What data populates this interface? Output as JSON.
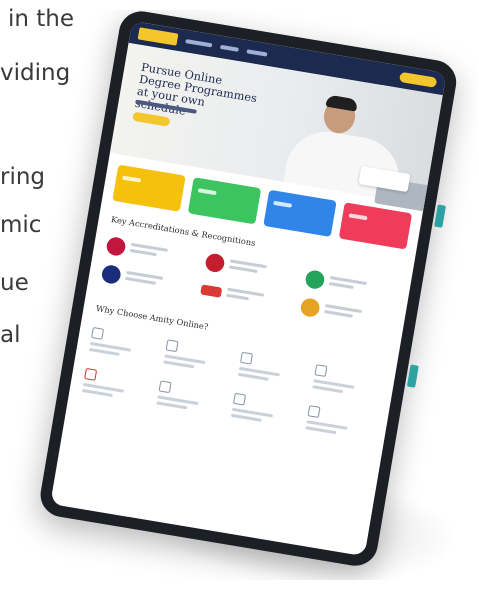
{
  "background_text_lines": [
    "in the",
    "viding",
    "ring",
    "mic",
    "ue",
    "al"
  ],
  "website": {
    "hero_title": "Pursue Online Degree Programmes at your own schedule",
    "section_accreditations": "Key Accreditations & Recognitions",
    "section_why": "Why Choose Amity Online?"
  },
  "colors": {
    "nav": "#1d2a4f",
    "accent": "#f3c62b",
    "tile_yellow": "#f4c20d",
    "tile_green": "#3cc461",
    "tile_blue": "#2f86e8",
    "tile_pink": "#ef3c5a"
  }
}
